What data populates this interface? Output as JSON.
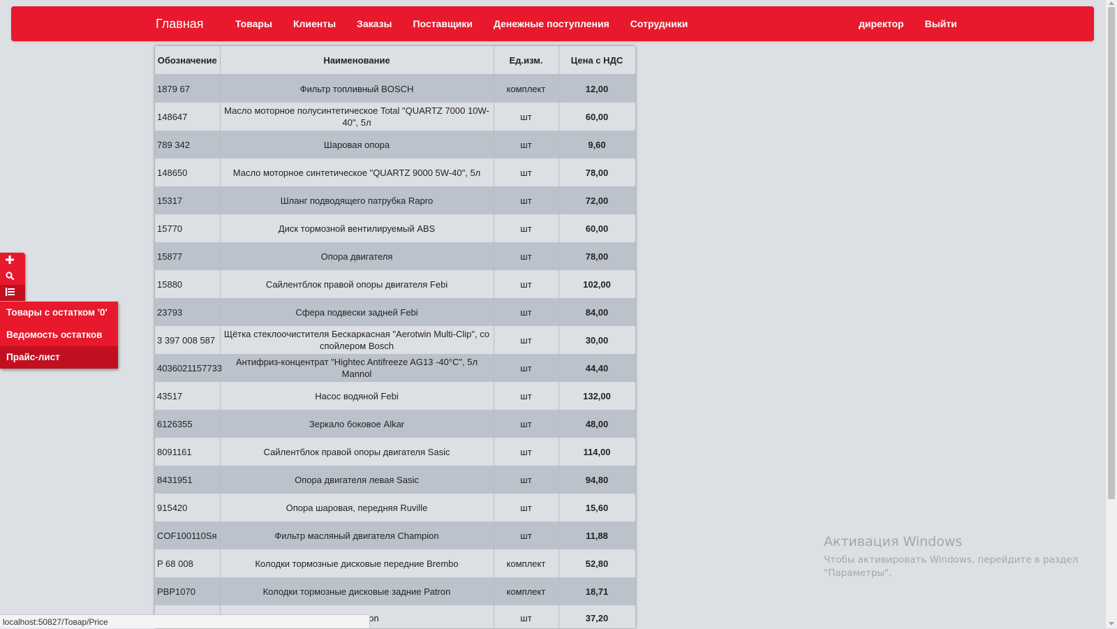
{
  "nav": {
    "brand": "Главная",
    "links": [
      "Товары",
      "Клиенты",
      "Заказы",
      "Поставщики",
      "Денежные поступления",
      "Сотрудники"
    ],
    "user": "директор",
    "logout": "Выйти",
    "accent_color": "#e8192c"
  },
  "table": {
    "headers": [
      "Обозначение",
      "Наименование",
      "Ед.изм.",
      "Цена с НДС"
    ],
    "rows": [
      {
        "code": "1879 67",
        "name": "Фильтр топливный BOSCH",
        "unit": "комплект",
        "price": "12,00"
      },
      {
        "code": "148647",
        "name": "Масло моторное полусинтетическое Total \"QUARTZ 7000 10W-40\", 5л",
        "unit": "шт",
        "price": "60,00"
      },
      {
        "code": "789 342",
        "name": "Шаровая опора",
        "unit": "шт",
        "price": "9,60"
      },
      {
        "code": "148650",
        "name": "Масло моторное синтетическое \"QUARTZ 9000 5W-40\", 5л",
        "unit": "шт",
        "price": "78,00"
      },
      {
        "code": "15317",
        "name": "Шланг подводящего патрубка Rapro",
        "unit": "шт",
        "price": "72,00"
      },
      {
        "code": "15770",
        "name": "Диск тормозной вентилируемый ABS",
        "unit": "шт",
        "price": "60,00"
      },
      {
        "code": "15877",
        "name": "Опора двигателя",
        "unit": "шт",
        "price": "78,00"
      },
      {
        "code": "15880",
        "name": "Сайлентблок правой опоры двигателя Febi",
        "unit": "шт",
        "price": "102,00"
      },
      {
        "code": "23793",
        "name": "Сфера подвески задней Febi",
        "unit": "шт",
        "price": "84,00"
      },
      {
        "code": "3 397 008 587",
        "name": "Щётка стеклоочистителя Бескаркасная \"Aerotwin Multi-Clip\", со спойлером Bosch",
        "unit": "шт",
        "price": "30,00"
      },
      {
        "code": "4036021157733",
        "name": "Антифриз-концентрат \"Hightec Antifreeze AG13 -40°C\", 5л Mannol",
        "unit": "шт",
        "price": "44,40"
      },
      {
        "code": "43517",
        "name": "Насос водяной Febi",
        "unit": "шт",
        "price": "132,00"
      },
      {
        "code": "6126355",
        "name": "Зеркало боковое Alkar",
        "unit": "шт",
        "price": "48,00"
      },
      {
        "code": "8091161",
        "name": "Сайлентблок правой опоры двигателя Sasic",
        "unit": "шт",
        "price": "114,00"
      },
      {
        "code": "8431951",
        "name": "Опора двигателя левая Sasic",
        "unit": "шт",
        "price": "94,80"
      },
      {
        "code": "915420",
        "name": "Опора шаровая, передняя Ruville",
        "unit": "шт",
        "price": "15,60"
      },
      {
        "code": "COF100110Sя",
        "name": "Фильтр масляный двигателя Champion",
        "unit": "шт",
        "price": "11,88"
      },
      {
        "code": "P 68 008",
        "name": "Колодки тормозные дисковые передние Brembo",
        "unit": "комплект",
        "price": "52,80"
      },
      {
        "code": "PBP1070",
        "name": "Колодки тормозные дисковые задние Patron",
        "unit": "комплект",
        "price": "18,71"
      },
      {
        "code": "",
        "name": "ния Patron",
        "unit": "шт",
        "price": "37,20"
      }
    ]
  },
  "side_tools": {
    "icons": [
      "plus-icon",
      "search-icon",
      "list-icon"
    ],
    "menu": [
      "Товары с остатком '0'",
      "Ведомость остатков",
      "Прайс-лист"
    ],
    "active_menu": "Прайс-лист"
  },
  "status_bar": {
    "url": "localhost:50827/Товар/Price"
  },
  "watermark": {
    "title": "Активация Windows",
    "text": "Чтобы активировать Windows, перейдите в раздел \"Параметры\"."
  }
}
